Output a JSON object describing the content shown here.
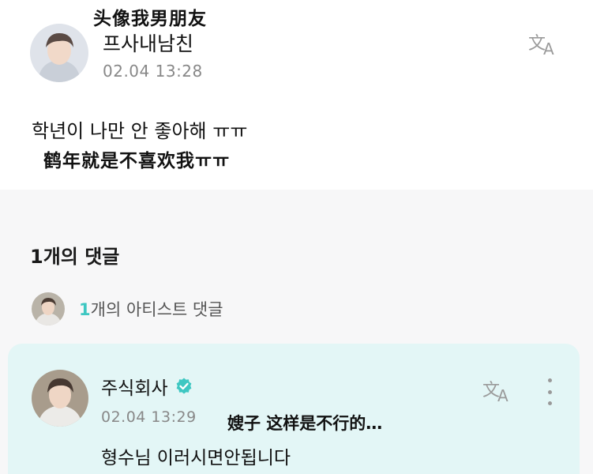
{
  "overlay": {
    "post_caption": "头像我男朋友",
    "body_caption": "鹤年就是不喜欢我ㅠㅠ",
    "comment_caption": "嫂子 这样是不行的…"
  },
  "post": {
    "author": "프사내남친",
    "timestamp": "02.04 13:28",
    "body": "학년이 나만 안 좋아해 ㅠㅠ",
    "translate_icon": "translate-icon"
  },
  "comments": {
    "heading": "1개의 댓글",
    "artist_row": {
      "count": "1",
      "label": "개의 아티스트 댓글"
    },
    "items": [
      {
        "author": "주식회사",
        "verified_icon": "verified-check-icon",
        "timestamp": "02.04 13:29",
        "body": "형수님 이러시면안됩니다",
        "more_icon": "more-vertical-icon"
      }
    ]
  },
  "colors": {
    "accent": "#3ec7c2",
    "comment_bg": "#e3f6f6",
    "muted_text": "#888888"
  }
}
